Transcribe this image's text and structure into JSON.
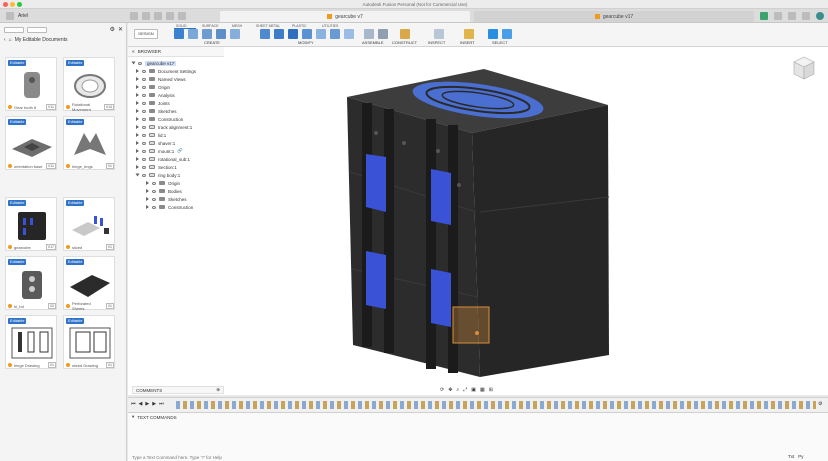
{
  "window": {
    "title": "Autodesk Fusion Personal (Not for Commercial Use)"
  },
  "tabs": [
    {
      "label": "gearcube v7"
    },
    {
      "label": "gearcube v17"
    }
  ],
  "data_panel": {
    "user": "Ariel",
    "breadcrumb": "My Editable Documents",
    "cards": [
      {
        "badge": "Editable",
        "name": "Gear tooth 8",
        "version": "V11"
      },
      {
        "badge": "Editable",
        "name": "Rotational Movement",
        "version": "V14"
      },
      {
        "badge": "Editable",
        "name": "orientation base",
        "version": "V11"
      },
      {
        "badge": "Editable",
        "name": "hinge_rings",
        "version": "V1"
      },
      {
        "badge": "Editable",
        "name": "gearcube",
        "version": "V17"
      },
      {
        "badge": "Editable",
        "name": "sliced",
        "version": "V1"
      },
      {
        "badge": "Editable",
        "name": "hi_bd",
        "version": "V2"
      },
      {
        "badge": "Editable",
        "name": "Perforated Sheets",
        "version": "V1"
      },
      {
        "badge": "Editable",
        "name": "hinge Drawing",
        "version": "V1"
      },
      {
        "badge": "Editable",
        "name": "sliced Drawing",
        "version": "V1"
      }
    ]
  },
  "toolbar": {
    "workspaces": [
      "SOLID",
      "SURFACE",
      "MESH",
      "SHEET METAL",
      "PLASTIC",
      "UTILITIES"
    ],
    "design_label": "DESIGN",
    "groups": [
      "CREATE",
      "MODIFY",
      "ASSEMBLE",
      "CONSTRUCT",
      "INSPECT",
      "INSERT",
      "SELECT"
    ]
  },
  "browser": {
    "header": "BROWSER",
    "root": "gearcube v17",
    "items": [
      "Document Settings",
      "Named Views",
      "Origin",
      "Analysis",
      "Joints",
      "Sketches",
      "Construction",
      "track alignment:1",
      "lid:1",
      "shaver:1",
      "mount:1",
      "rotational_sub:1",
      "Section:1",
      "ring body:1",
      "Origin",
      "Bodies",
      "Sketches",
      "Construction"
    ]
  },
  "comments": {
    "label": "COMMENTS"
  },
  "command": {
    "header": "TEXT COMMANDS",
    "placeholder": "Type a Text Command here. Type '?' for Help",
    "mode": "Txt",
    "mode2": "Py"
  },
  "colors": {
    "accent": "#2e73c8",
    "panel_blue": "#3a52d6",
    "cube_dark": "#2a2a2a",
    "selection_orange": "#d98e3a"
  }
}
